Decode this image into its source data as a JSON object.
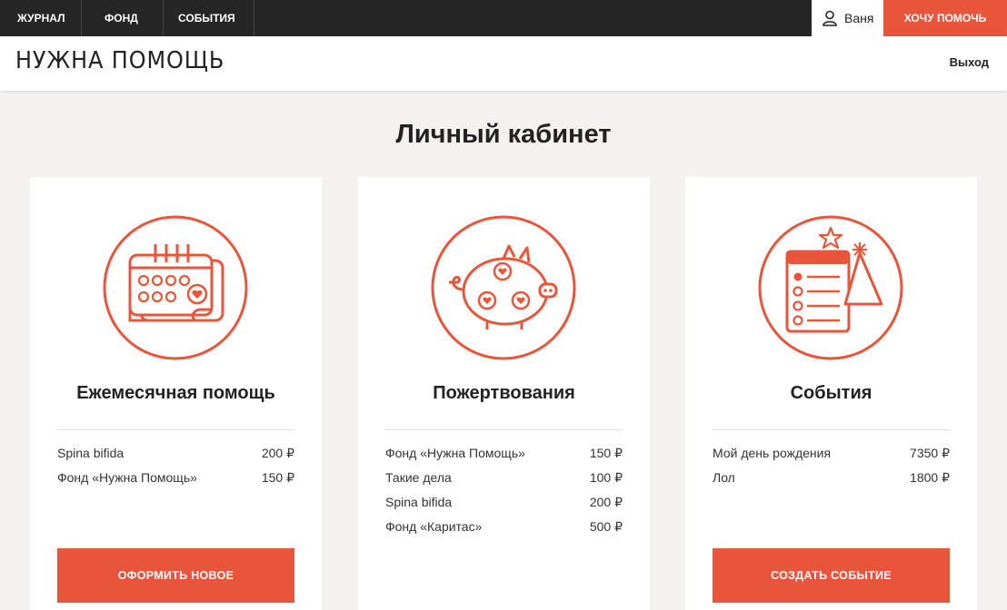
{
  "topbar": {
    "nav": [
      "ЖУРНАЛ",
      "ФОНД",
      "СОБЫТИЯ"
    ],
    "user_name": "Ваня",
    "help_button": "ХОЧУ ПОМОЧЬ"
  },
  "header": {
    "logo": "НУЖНА ПОМОЩЬ",
    "logout": "Выход"
  },
  "page_title": "Личный кабинет",
  "accent_color": "#e8553a",
  "cards": [
    {
      "icon": "calendar-icon",
      "title": "Ежемесячная помощь",
      "items": [
        {
          "name": "Spina bifida",
          "amount": "200 ₽"
        },
        {
          "name": "Фонд «Нужна Помощь»",
          "amount": "150 ₽"
        }
      ],
      "button": "ОФОРМИТЬ НОВОЕ"
    },
    {
      "icon": "piggy-bank-icon",
      "title": "Пожертвования",
      "items": [
        {
          "name": "Фонд «Нужна Помощь»",
          "amount": "150 ₽"
        },
        {
          "name": "Такие дела",
          "amount": "100 ₽"
        },
        {
          "name": "Spina bifida",
          "amount": "200 ₽"
        },
        {
          "name": "Фонд «Каритас»",
          "amount": "500 ₽"
        }
      ]
    },
    {
      "icon": "event-list-icon",
      "title": "События",
      "items": [
        {
          "name": "Мой день рождения",
          "amount": "7350 ₽"
        },
        {
          "name": "Лол",
          "amount": "1800 ₽"
        }
      ],
      "button": "СОЗДАТЬ СОБЫТИЕ"
    }
  ]
}
